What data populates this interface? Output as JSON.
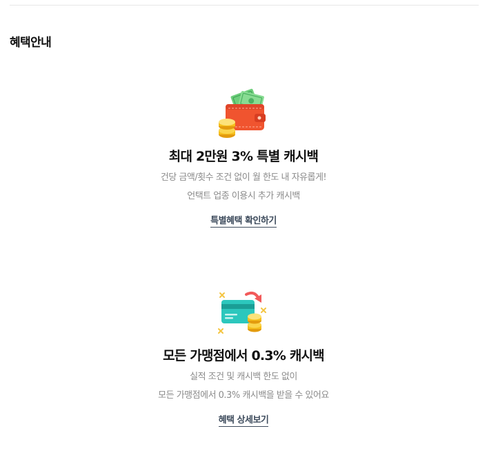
{
  "section": {
    "title": "혜택안내"
  },
  "benefits": [
    {
      "icon": "wallet-coins-icon",
      "headline": "최대 2만원 3% 특별 캐시백",
      "desc_line1": "건당 금액/횟수 조건 없이 월 한도 내 자유롭게!",
      "desc_line2": "언택트 업종 이용시 추가 캐시백",
      "link_label": "특별혜택 확인하기"
    },
    {
      "icon": "card-coins-icon",
      "headline": "모든 가맹점에서 0.3% 캐시백",
      "desc_line1": "실적 조건 및 캐시백 한도 없이",
      "desc_line2": "모든 가맹점에서 0.3% 캐시백을 받을 수 있어요",
      "link_label": "혜택 상세보기"
    }
  ],
  "colors": {
    "link": "#3d4b5c",
    "desc": "#8b8b8b",
    "wallet": "#f0542f",
    "card": "#2cc7bd",
    "coin": "#f6bf1c"
  }
}
